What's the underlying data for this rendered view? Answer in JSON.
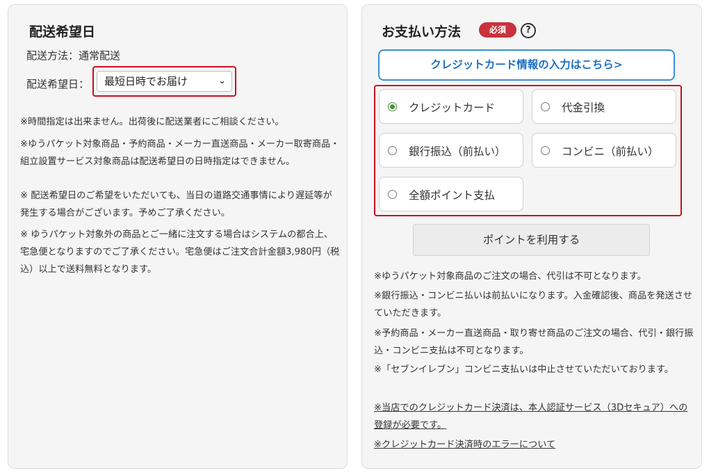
{
  "delivery": {
    "title": "配送希望日",
    "method_text": "配送方法：通常配送",
    "date_label": "配送希望日：",
    "date_select_value": "最短日時でお届け",
    "notes": [
      "※時間指定は出来ません。出荷後に配送業者にご相談ください。",
      "※ゆうパケット対象商品・予約商品・メーカー直送商品・メーカー取寄商品・組立設置サービス対象商品は配送希望日の日時指定はできません。",
      "※ 配送希望日のご希望をいただいても、当日の道路交通事情により遅延等が発生する場合がございます。予めご了承ください。",
      "※ ゆうパケット対象外の商品とご一緒に注文する場合はシステムの都合上、宅急便となりますのでご了承ください。宅急便はご注文合計金額3,980円（税込）以上で送料無料となります。"
    ]
  },
  "payment": {
    "title": "お支払い方法",
    "required_badge": "必須",
    "help_icon": "?",
    "cc_link_label": "クレジットカード情報の入力はこちら>",
    "methods": [
      {
        "label": "クレジットカード",
        "checked": true
      },
      {
        "label": "代金引換",
        "checked": false
      },
      {
        "label": "銀行振込（前払い）",
        "checked": false
      },
      {
        "label": "コンビニ（前払い）",
        "checked": false
      },
      {
        "label": "全額ポイント支払",
        "checked": false
      }
    ],
    "use_points_label": "ポイントを利用する",
    "notes": [
      "※ゆうパケット対象商品のご注文の場合、代引は不可となります。",
      "※銀行振込・コンビニ払いは前払いになります。入金確認後、商品を発送させていただきます。",
      "※予約商品・メーカー直送商品・取り寄せ商品のご注文の場合、代引・銀行振込・コンビニ支払は不可となります。",
      "※「セブンイレブン」コンビニ支払いは中止させていただいております。"
    ],
    "links": [
      "※当店でのクレジットカード決済は、本人認証サービス（3Dセキュア）への登録が必要です。",
      "※クレジットカード決済時のエラーについて"
    ]
  },
  "colors": {
    "highlight_red": "#c8101e",
    "badge_red": "#c8323c",
    "link_blue": "#1d6fc4",
    "radio_green": "#4a8f3a"
  }
}
